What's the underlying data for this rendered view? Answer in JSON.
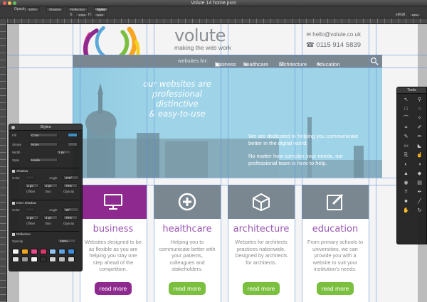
{
  "window": {
    "title": "Volute 14 home.pxm"
  },
  "toolbar": {
    "opacity_label": "Opacity:",
    "opacity_value": "100%",
    "shadow": "Shadow",
    "reflection": "Reflection",
    "styles": "Styles",
    "x_label": "X:",
    "x_value": "1336",
    "y_label": "H:",
    "y_value": "1820",
    "color_mode": "sRGB",
    "zoom": "86%"
  },
  "site": {
    "brand": "volute",
    "tagline": "making the web work",
    "email": "hello@volute.co.uk",
    "phone": "0115 914 5839",
    "nav_lead": "websites for:",
    "nav": [
      "business",
      "healthcare",
      "architecture",
      "education"
    ],
    "hero_heading": [
      "our websites are",
      "professional",
      "distinctive",
      "& easy-to-use"
    ],
    "hero_text": [
      "We are dedicated to helping you communicate better in the digital world.",
      "No matter how complex your needs, our professional team is here to help."
    ],
    "cards": [
      {
        "title": "business",
        "body": "Websites designed to be as flexible as you are helping you stay one step ahead of the competition.",
        "button": "read more",
        "color": "#8e2a8f",
        "btn_color": "#8e2a8f"
      },
      {
        "title": "healthcare",
        "body": "Helping you to communicate better with your patients, colleagues and stakeholders.",
        "button": "read more",
        "color": "#7b8790",
        "btn_color": "#7bbf3f"
      },
      {
        "title": "architecture",
        "body": "Websites for architects practices nationwide. Designed by architects for architects.",
        "button": "read more",
        "color": "#7b8790",
        "btn_color": "#7bbf3f"
      },
      {
        "title": "education",
        "body": "From primary schools to universities, we can provide you with a website to suit your institution's needs.",
        "button": "read more",
        "color": "#7b8790",
        "btn_color": "#7bbf3f"
      }
    ]
  },
  "styles_panel": {
    "title": "Styles",
    "fill_label": "Fill",
    "fill_value": "Color",
    "stroke_label": "Stroke",
    "stroke_value": "None",
    "width_label": "Width",
    "width_value": "1 px",
    "style_label": "Style",
    "style_value": "Inside",
    "shadow_label": "Shadow",
    "shadow_color_label": "Color",
    "shadow_angle_label": "Angle",
    "shadow_angle_value": "270°",
    "shadow_offset_label": "Offset",
    "shadow_blur_label": "Blur",
    "shadow_opacity_label": "Opacity",
    "shadow_offset_value": "2 px",
    "shadow_blur_value": "2 px",
    "shadow_opacity_value": "75%",
    "inner_shadow_label": "Inner Shadow",
    "inner_angle_value": "90°",
    "inner_offset_value": "2 px",
    "inner_blur_value": "4 px",
    "inner_opacity_value": "75%",
    "reflection_label": "Reflection",
    "opacity_label": "Opacity",
    "opacity_value": "100%",
    "swatch_colors": [
      "#f2f2f2",
      "#f0a420",
      "#e84a8d",
      "#d9366f",
      "#8fc4f0",
      "#5fa3e0",
      "#3c8fe0",
      "#e0e0e0",
      "#9a9a9a",
      "#f2f2f2",
      "#2f2f2f",
      "#d4d4d4",
      "#bdbdbd",
      "#d0d0d0"
    ]
  },
  "tools_panel": {
    "title": "Tools",
    "tools": [
      "move",
      "zoom",
      "rect-select",
      "ellipse-select",
      "lasso",
      "magic-wand",
      "crop",
      "eyedropper",
      "brush",
      "pencil",
      "eraser",
      "paint-bucket",
      "clone",
      "smudge",
      "dodge",
      "burn",
      "sharpen",
      "blur",
      "red-eye",
      "sponge",
      "text",
      "pen",
      "shape",
      "line",
      "hand",
      "rotate"
    ]
  }
}
